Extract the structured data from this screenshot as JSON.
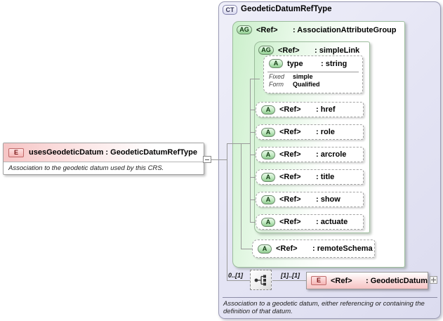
{
  "palette": {
    "element_accent": "#f6c4c4",
    "group_accent": "#cbefcb",
    "container_accent": "#e4e4f4"
  },
  "left_element": {
    "badge": "E",
    "title": "usesGeodeticDatum : GeodeticDatumRefType",
    "annotation": "Association to the geodetic datum used by this CRS."
  },
  "complex_type": {
    "badge": "CT",
    "name": "GeodeticDatumRefType",
    "annotation_line1": "Association to a geodetic datum, either referencing or containing the",
    "annotation_line2": "definition of that datum.",
    "attribute_group": {
      "badge": "AG",
      "ref": "<Ref>",
      "name": ": AssociationAttributeGroup",
      "simple_link": {
        "badge": "AG",
        "ref": "<Ref>",
        "name": ": simpleLink",
        "type_attribute": {
          "badge": "A",
          "name": "type",
          "type": ": string",
          "facets": [
            {
              "label": "Fixed",
              "value": "simple"
            },
            {
              "label": "Form",
              "value": "Qualified"
            }
          ]
        },
        "attributes": [
          {
            "badge": "A",
            "ref": "<Ref>",
            "name": ": href"
          },
          {
            "badge": "A",
            "ref": "<Ref>",
            "name": ": role"
          },
          {
            "badge": "A",
            "ref": "<Ref>",
            "name": ": arcrole"
          },
          {
            "badge": "A",
            "ref": "<Ref>",
            "name": ": title"
          },
          {
            "badge": "A",
            "ref": "<Ref>",
            "name": ": show"
          },
          {
            "badge": "A",
            "ref": "<Ref>",
            "name": ": actuate"
          }
        ]
      },
      "remote_schema": {
        "badge": "A",
        "ref": "<Ref>",
        "name": ": remoteSchema"
      }
    },
    "sequence": {
      "left_multiplicity": "0..[1]",
      "right_multiplicity": "[1]..[1]"
    },
    "child_element": {
      "badge": "E",
      "ref": "<Ref>",
      "name": ": GeodeticDatum"
    }
  }
}
